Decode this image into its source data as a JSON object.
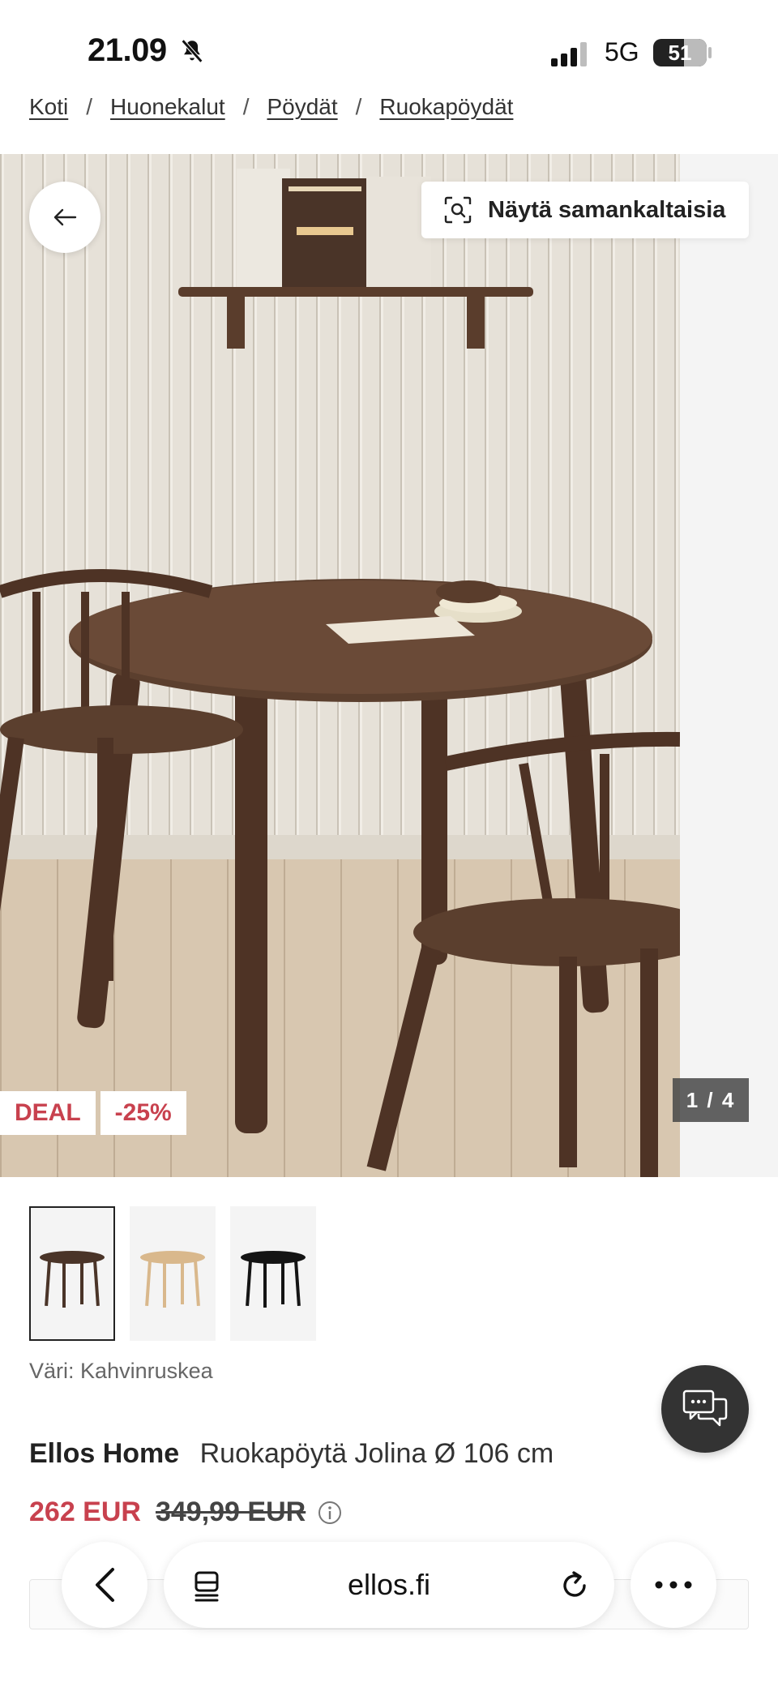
{
  "status_bar": {
    "time": "21.09",
    "network": "5G",
    "battery": "51"
  },
  "breadcrumb": {
    "items": [
      "Koti",
      "Huonekalut",
      "Pöydät",
      "Ruokapöydät"
    ],
    "separator": "/"
  },
  "gallery": {
    "similar_button_label": "Näytä samankaltaisia",
    "badges": [
      "DEAL",
      "-25%"
    ],
    "counter": "1 / 4",
    "thumbnails": [
      {
        "color": "#4a3428"
      },
      {
        "color": "#d9b88c"
      },
      {
        "color": "#141414"
      }
    ]
  },
  "product": {
    "color_label": "Väri:",
    "color_value": "Kahvinruskea",
    "brand": "Ellos Home",
    "name": "Ruokapöytä Jolina Ø 106 cm",
    "price_now": "262 EUR",
    "price_old": "349,99 EUR"
  },
  "browser": {
    "domain": "ellos.fi"
  },
  "colors": {
    "accent_red": "#c8414e",
    "table_brown": "#5b3f2e"
  }
}
